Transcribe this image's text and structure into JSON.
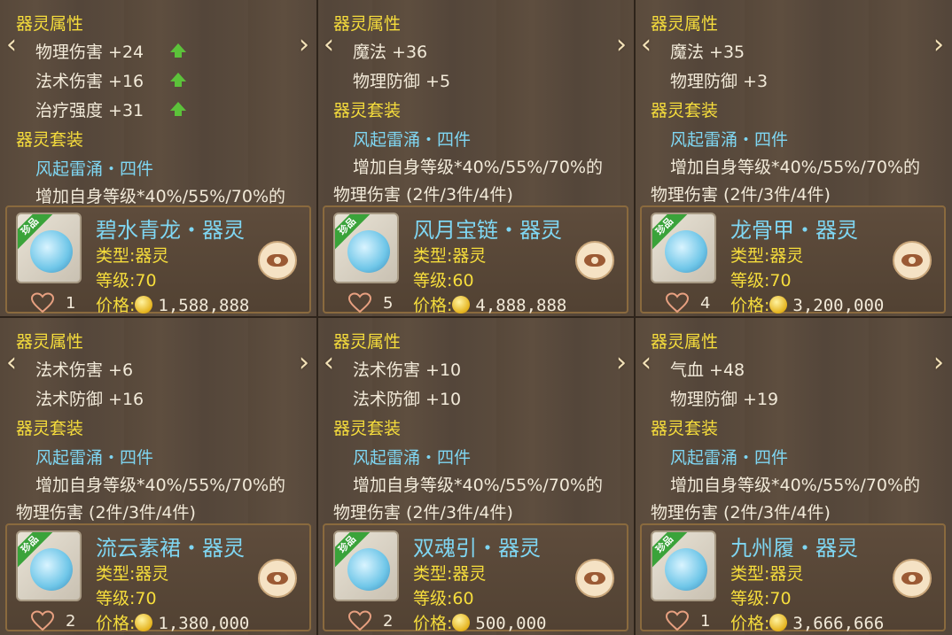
{
  "labels": {
    "attr_header": "器灵属性",
    "set_header": "器灵套装",
    "type_label": "类型:",
    "level_label": "等级:",
    "price_label": "价格:",
    "rare_tag": "珍品"
  },
  "cells": [
    {
      "attrs": [
        {
          "text": "物理伤害 +24",
          "up": true
        },
        {
          "text": "法术伤害 +16",
          "up": true
        },
        {
          "text": "治疗强度 +31",
          "up": true
        }
      ],
      "set_name": "风起雷涌・四件",
      "set_desc_1": "增加自身等级*40%/55%/70%的",
      "set_desc_2": "",
      "item_name": "碧水青龙・器灵",
      "type": "器灵",
      "level": "70",
      "likes": "1",
      "price": "1,588,888"
    },
    {
      "attrs": [
        {
          "text": "魔法 +36",
          "up": false
        },
        {
          "text": "物理防御 +5",
          "up": false
        }
      ],
      "set_name": "风起雷涌・四件",
      "set_desc_1": "增加自身等级*40%/55%/70%的",
      "set_desc_2": "物理伤害 (2件/3件/4件)",
      "item_name": "风月宝链・器灵",
      "type": "器灵",
      "level": "60",
      "likes": "5",
      "price": "4,888,888"
    },
    {
      "attrs": [
        {
          "text": "魔法 +35",
          "up": false
        },
        {
          "text": "物理防御 +3",
          "up": false
        }
      ],
      "set_name": "风起雷涌・四件",
      "set_desc_1": "增加自身等级*40%/55%/70%的",
      "set_desc_2": "物理伤害 (2件/3件/4件)",
      "item_name": "龙骨甲・器灵",
      "type": "器灵",
      "level": "70",
      "likes": "4",
      "price": "3,200,000"
    },
    {
      "attrs": [
        {
          "text": "法术伤害 +6",
          "up": false
        },
        {
          "text": "法术防御 +16",
          "up": false
        }
      ],
      "set_name": "风起雷涌・四件",
      "set_desc_1": "增加自身等级*40%/55%/70%的",
      "set_desc_2": "物理伤害 (2件/3件/4件)",
      "item_name": "流云素裙・器灵",
      "type": "器灵",
      "level": "70",
      "likes": "2",
      "price": "1,380,000"
    },
    {
      "attrs": [
        {
          "text": "法术伤害 +10",
          "up": false
        },
        {
          "text": "法术防御 +10",
          "up": false
        }
      ],
      "set_name": "风起雷涌・四件",
      "set_desc_1": "增加自身等级*40%/55%/70%的",
      "set_desc_2": "物理伤害 (2件/3件/4件)",
      "item_name": "双魂引・器灵",
      "type": "器灵",
      "level": "60",
      "likes": "2",
      "price": "500,000"
    },
    {
      "attrs": [
        {
          "text": "气血 +48",
          "up": false
        },
        {
          "text": "物理防御 +19",
          "up": false
        }
      ],
      "set_name": "风起雷涌・四件",
      "set_desc_1": "增加自身等级*40%/55%/70%的",
      "set_desc_2": "物理伤害 (2件/3件/4件)",
      "item_name": "九州履・器灵",
      "type": "器灵",
      "level": "70",
      "likes": "1",
      "price": "3,666,666"
    }
  ]
}
